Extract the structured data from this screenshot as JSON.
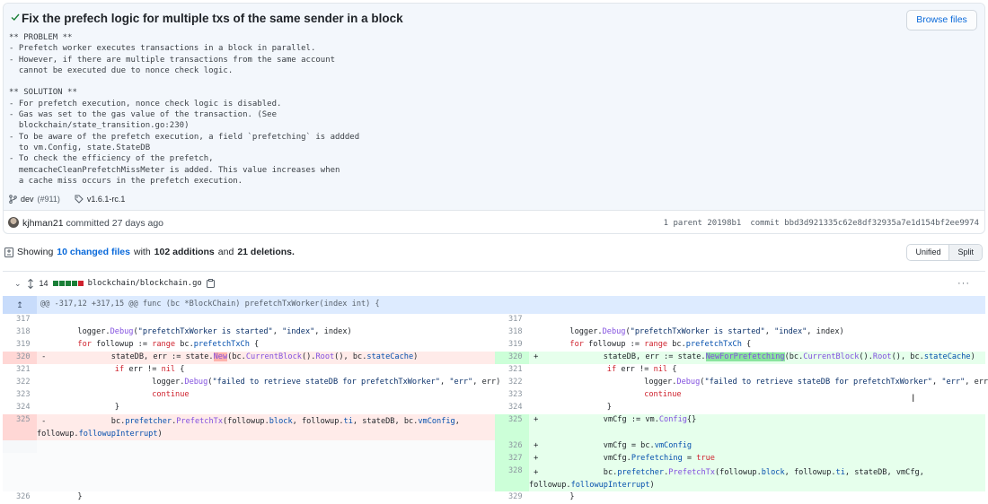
{
  "commit": {
    "title": "Fix the prefech logic for multiple txs of the same sender in a block",
    "browse_label": "Browse files",
    "description": "** PROBLEM **\n- Prefetch worker executes transactions in a block in parallel.\n- However, if there are multiple transactions from the same account\n  cannot be executed due to nonce check logic.\n\n** SOLUTION **\n- For prefetch execution, nonce check logic is disabled.\n- Gas was set to the gas value of the transaction. (See\n  blockchain/state_transition.go:230)\n- To be aware of the prefetch execution, a field `prefetching` is addded\n  to vm.Config, state.StateDB\n- To check the efficiency of the prefetch,\n  memcacheCleanPrefetchMissMeter is added. This value increases when\n  a cache miss occurs in the prefetch execution.",
    "branch": "dev",
    "pr": "(#911)",
    "tag": "v1.6.1-rc.1",
    "author": "kjhman21",
    "committed": "committed 27 days ago",
    "parents": "1 parent 20198b1",
    "commit_hash": "commit bbd3d921335c62e8df32935a7e1d154bf2ee9974"
  },
  "summary": {
    "prefix": "Showing",
    "files_link": "10 changed files",
    "with": "with",
    "additions": "102 additions",
    "and": "and",
    "deletions": "21 deletions.",
    "unified_label": "Unified",
    "split_label": "Split"
  },
  "file": {
    "count": "14",
    "path": "blockchain/blockchain.go",
    "hunk_header": "@@ -317,12 +317,15 @@ func (bc *BlockChain) prefetchTxWorker(index int) {"
  },
  "colors": {
    "accent": "#0969da",
    "deletion": "#ffebe9",
    "addition": "#e6ffec",
    "hunk": "#ddebff"
  },
  "icons": [
    "check-icon",
    "branch-icon",
    "tag-icon",
    "file-diff-icon",
    "chevron-down-icon",
    "expand-up-down-icon",
    "clipboard-icon",
    "kebab-icon",
    "expand-up-icon",
    "text-cursor-icon"
  ]
}
